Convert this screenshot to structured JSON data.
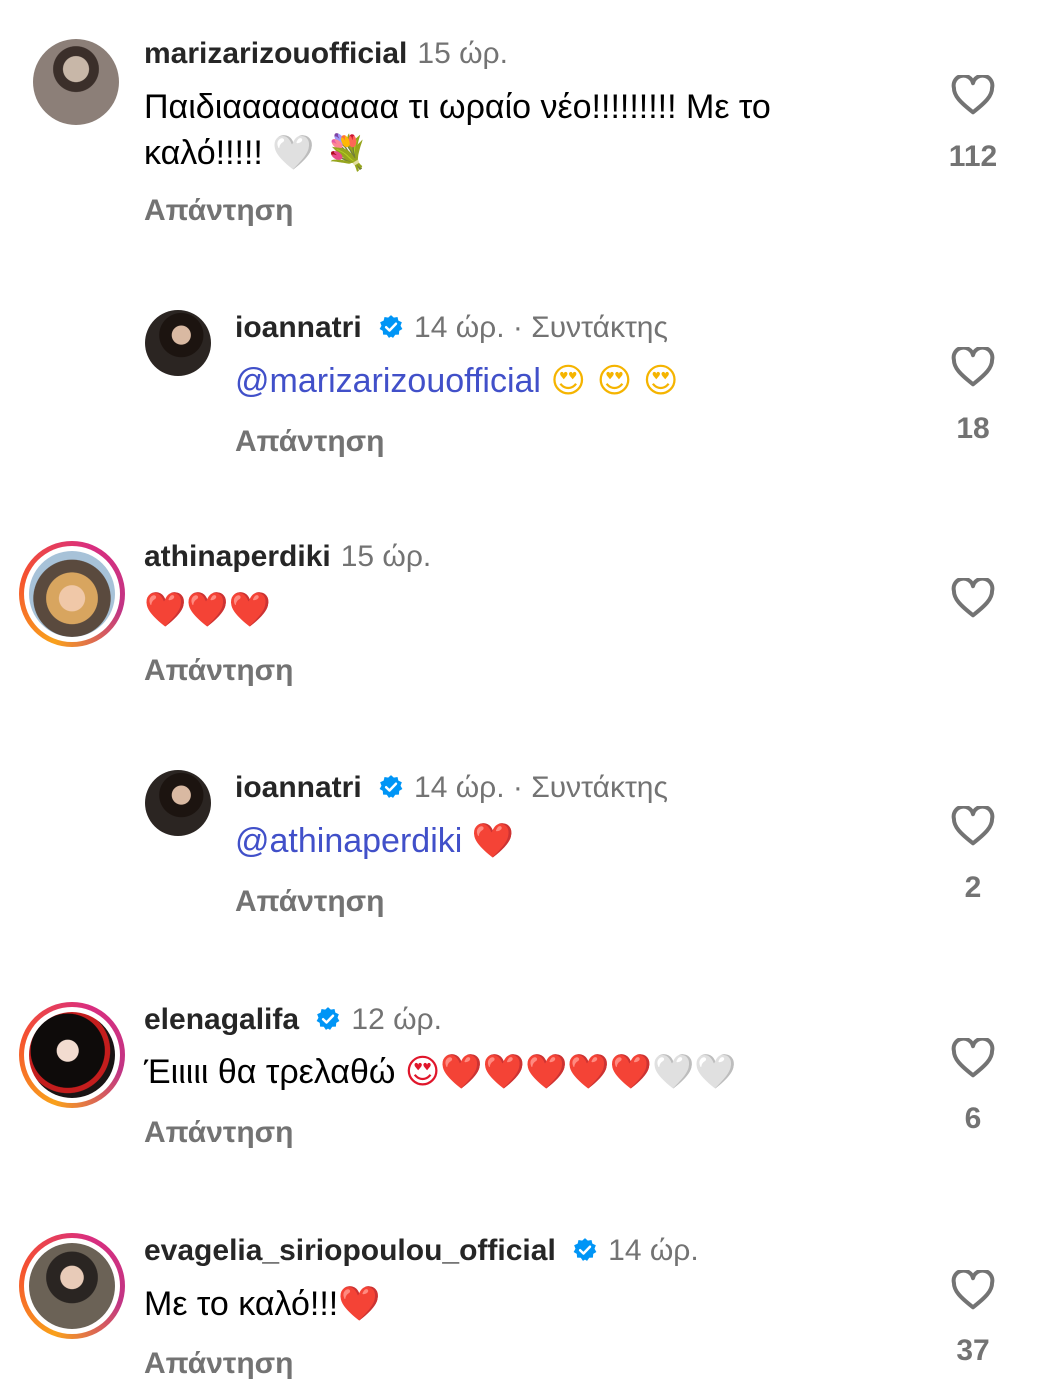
{
  "comments": [
    {
      "username": "marizarizouofficial",
      "time": "15 ώρ.",
      "text_line1": "Παιδιααααααααα τι ωραίο νέο!!!!!!!!! Με το",
      "text_line2": "καλό!!!!!",
      "emoji": "🤍 💐",
      "reply_label": "Απάντηση",
      "likes": "112"
    },
    {
      "username": "ioannatri",
      "time": "14 ώρ. · Συντάκτης",
      "mention": "@marizarizouofficial",
      "emoji": "😍 😍 😍",
      "reply_label": "Απάντηση",
      "likes": "18"
    },
    {
      "username": "athinaperdiki",
      "time": "15 ώρ.",
      "emoji": "❤️❤️❤️",
      "reply_label": "Απάντηση",
      "likes": ""
    },
    {
      "username": "ioannatri",
      "time": "14 ώρ. · Συντάκτης",
      "mention": "@athinaperdiki",
      "emoji": "❤️",
      "reply_label": "Απάντηση",
      "likes": "2"
    },
    {
      "username": "elenagalifa",
      "time": "12 ώρ.",
      "text": "Έιιιιι θα τρελαθώ",
      "emoji": "😍❤️❤️❤️❤️❤️🤍🤍",
      "reply_label": "Απάντηση",
      "likes": "6"
    },
    {
      "username": "evagelia_siriopoulou_official",
      "time": "14 ώρ.",
      "text": "Με το καλό!!!",
      "emoji": "❤️",
      "reply_label": "Απάντηση",
      "likes": "37"
    }
  ],
  "colors": {
    "mention": "#4150c9",
    "muted": "#737373",
    "verified": "#0095f6",
    "heart_outline": "#737373"
  },
  "icons": [
    "heart-outline-icon",
    "verified-badge-icon"
  ]
}
